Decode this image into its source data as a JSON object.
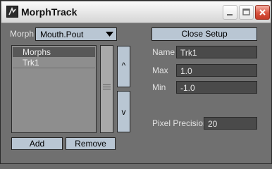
{
  "window": {
    "title": "MorphTrack"
  },
  "morph": {
    "label": "Morph",
    "selected": "Mouth.Pout"
  },
  "list": {
    "header": "Morphs",
    "items": [
      "Trk1"
    ]
  },
  "scroll": {
    "up_label": "^",
    "down_label": "v"
  },
  "buttons": {
    "add": "Add",
    "remove": "Remove",
    "close_setup": "Close Setup"
  },
  "fields": {
    "name_label": "Name",
    "name_value": "Trk1",
    "max_label": "Max",
    "max_value": "1.0",
    "min_label": "Min",
    "min_value": "-1.0",
    "precision_label": "Pixel Precision",
    "precision_value": "20"
  },
  "icons": {
    "app": "morph-app-icon",
    "minimize": "minimize-icon",
    "maximize": "maximize-icon",
    "close": "close-icon",
    "dropdown": "chevron-down-icon"
  },
  "colors": {
    "panel": "#707070",
    "button": "#b9c6d3",
    "field": "#4a4a4a",
    "close_button": "#d9533f"
  }
}
